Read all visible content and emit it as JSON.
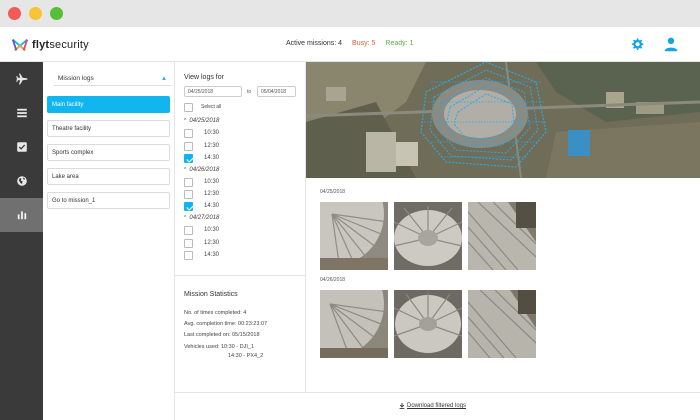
{
  "brand": {
    "logo_text_bold": "flyt",
    "logo_text_rest": "security",
    "accent": "#12b6ef"
  },
  "header": {
    "active_missions": "Active missions: 4",
    "busy": "Busy: 5",
    "ready": "Ready: 1",
    "icons": [
      "gear-icon",
      "user-icon"
    ]
  },
  "sidebar": {
    "items": [
      {
        "icon": "airplane-icon",
        "active": false
      },
      {
        "icon": "list-icon",
        "active": false
      },
      {
        "icon": "checkbox-icon",
        "active": false
      },
      {
        "icon": "globe-icon",
        "active": false
      },
      {
        "icon": "bar-chart-icon",
        "active": true
      }
    ]
  },
  "missions": {
    "selector": "Mission logs",
    "items": [
      "Main facility",
      "Theatre facility",
      "Sports complex",
      "Lake area",
      "Go to mission_1"
    ],
    "selected": "Main facility"
  },
  "logs": {
    "title": "View logs for",
    "from_date": "04/25/2018",
    "to_label": "to",
    "to_date": "05/04/2018",
    "select_all": "Select all",
    "dates": [
      {
        "date": "04/25/2018",
        "times": [
          {
            "time": "10:30",
            "checked": false
          },
          {
            "time": "12:30",
            "checked": false
          },
          {
            "time": "14:30",
            "checked": true
          }
        ]
      },
      {
        "date": "04/26/2018",
        "times": [
          {
            "time": "10:30",
            "checked": false
          },
          {
            "time": "12:30",
            "checked": false
          },
          {
            "time": "14:30",
            "checked": true
          }
        ]
      },
      {
        "date": "04/27/2018",
        "times": [
          {
            "time": "10:30",
            "checked": false
          },
          {
            "time": "12:30",
            "checked": false
          },
          {
            "time": "14:30",
            "checked": false
          }
        ]
      }
    ]
  },
  "stats": {
    "title": "Mission Statistics",
    "times_completed": "No. of times completed: 4",
    "avg_time": "Avg. completion time: 00:23:23:07",
    "last_completed": "Last completed on: 05/15/2018",
    "vehicles_1": "Vehicles used: 10:30 - DJI_1",
    "vehicles_2": "14:30 - PX4_2"
  },
  "gallery": {
    "groups": [
      {
        "date": "04/25/2018"
      },
      {
        "date": "04/26/2018"
      }
    ]
  },
  "footer": {
    "download": "Download filtered logs"
  }
}
